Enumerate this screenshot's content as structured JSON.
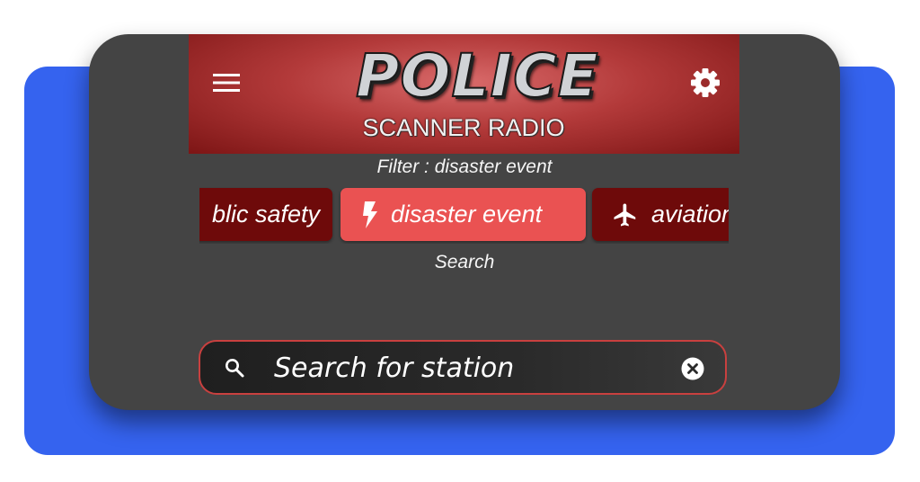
{
  "header": {
    "logo_title": "POLICE",
    "logo_subtitle": "SCANNER RADIO",
    "menu_icon": "hamburger-menu-icon",
    "settings_icon": "gear-icon"
  },
  "filter": {
    "label": "Filter : disaster event"
  },
  "chips": [
    {
      "label": "public safety",
      "visible_text": "blic safety",
      "icon": null,
      "active": false
    },
    {
      "label": "disaster event",
      "visible_text": "disaster event",
      "icon": "lightning-icon",
      "active": true
    },
    {
      "label": "aviation",
      "visible_text": "aviation",
      "icon": "airplane-icon",
      "active": false
    }
  ],
  "search": {
    "label": "Search",
    "placeholder": "Search for station",
    "icon": "search-icon",
    "clear_icon": "clear-icon"
  },
  "colors": {
    "page_background": "#ffffff",
    "accent_blue": "#3563ef",
    "card_background": "#444444",
    "header_red": "#b33a3a",
    "chip_active": "#ea5252",
    "chip_inactive": "#6e0a0a",
    "search_border": "#c9403f"
  }
}
